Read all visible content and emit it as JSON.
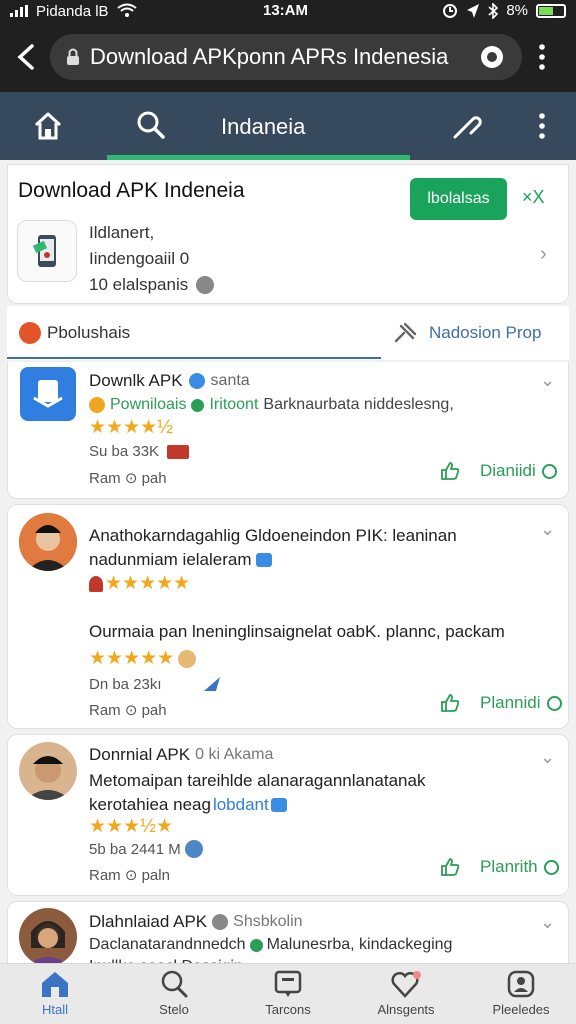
{
  "status": {
    "carrier": "Pidanda lB",
    "time": "13:AM",
    "battery": "8%"
  },
  "url_bar": {
    "text": "Download APKponn APRs Indenesia"
  },
  "nav": {
    "title": "Indaneia"
  },
  "header_card": {
    "title": "Download APK Indeneia",
    "button_label": "lbolalsas",
    "close_label": "×X",
    "line1": "Ildlanert,",
    "line2": "Iindengoaiil 0",
    "line3": "10 elalspanis"
  },
  "filter": {
    "label": "Pbolushais",
    "right_label": "Nadosion Prop"
  },
  "items": [
    {
      "title": "Downlk APK",
      "verified_text": "santa",
      "subtitle_green": "Powniloais",
      "subtitle_green2": "Iritoont",
      "subtitle_rest": "Barknaurbata niddeslesng,",
      "stars": "★★★★½",
      "meta": "Su ba 33K",
      "footer": "Ram ⊙ pah",
      "action": "Dianiidi"
    },
    {
      "text_line1": "Anathokarndagahlig Gldoeneindon PIK: leaninan",
      "text_line2": "nadunmiam ielaleram",
      "stars": "★★★★★",
      "text_line3": "Ourmaia pan lneninglinsaignelat oabK. plannc, packam",
      "stars2": "★★★★★",
      "meta": "Dn ba 23kı",
      "footer": "Ram ⊙ pah",
      "action": "Plannidi"
    },
    {
      "title": "Donrnial APK",
      "title_rest": "0 ki Akama",
      "text_line1": "Metomaipan tareihlde alanaragannlanatanak",
      "text_line2": "kerotahiea neag",
      "text_line2_blue": "lobdant",
      "stars": "★★★½★",
      "meta": "5b ba 2441 M",
      "footer": "Ram ⊙ paln",
      "action": "Planrith"
    },
    {
      "title": "Dlahnlaiad APK",
      "title_rest": "Shsbkolin",
      "text_line1": "Daclanatarandnnedch",
      "text_line1_rest": "Malunesrba, kindackeging",
      "text_line2": "Inullke seacl Dessigin"
    }
  ],
  "bottom_nav": [
    {
      "label": "Htall",
      "icon": "home-icon"
    },
    {
      "label": "Stelo",
      "icon": "search-icon"
    },
    {
      "label": "Tarcons",
      "icon": "chat-icon"
    },
    {
      "label": "Alnsgents",
      "icon": "heart-icon"
    },
    {
      "label": "Pleeledes",
      "icon": "profile-icon"
    }
  ]
}
